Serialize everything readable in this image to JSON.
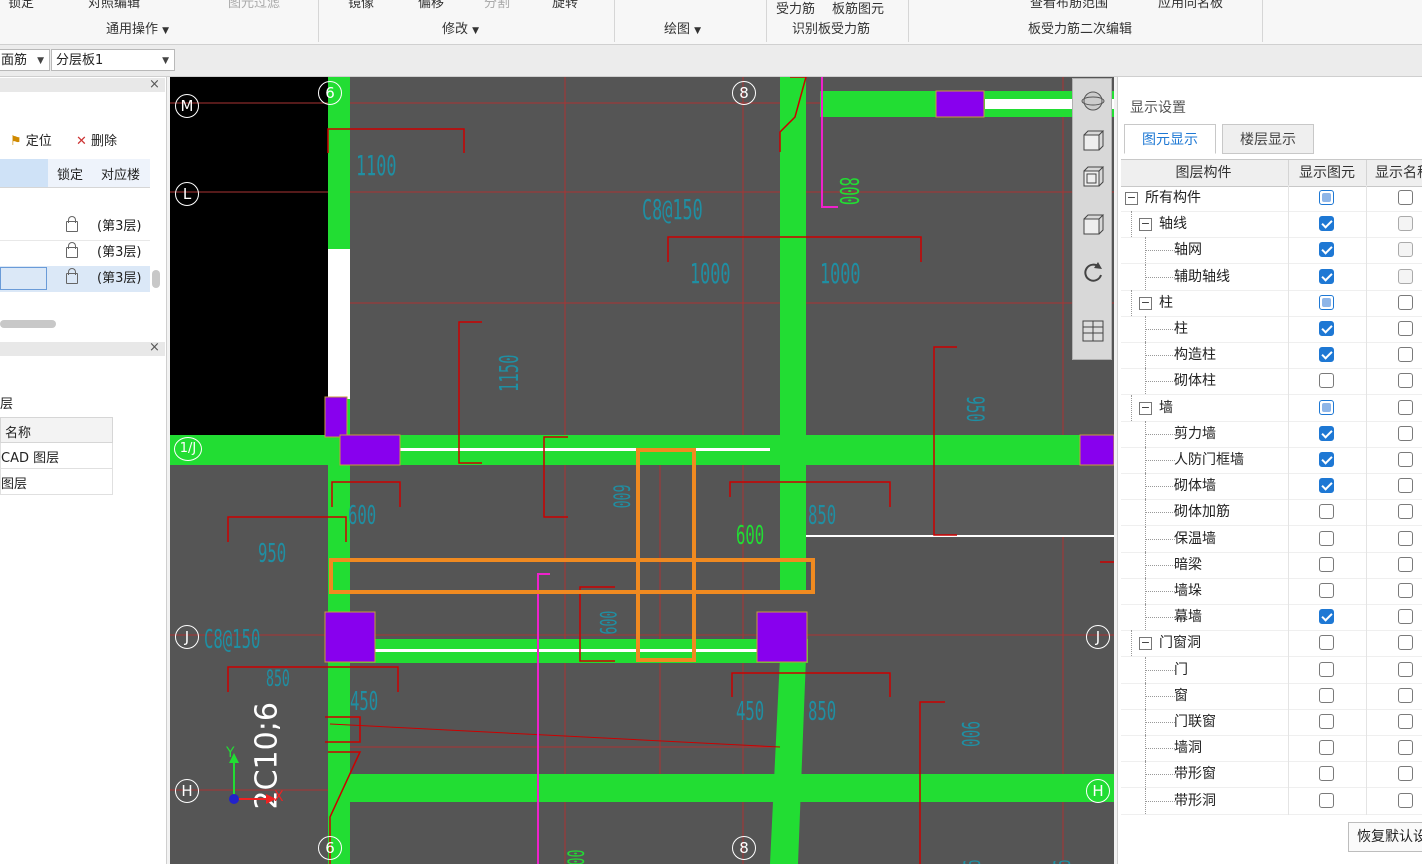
{
  "ribbon": {
    "top_items": [
      "锁定",
      "对照编辑",
      "图元过滤",
      "镜像",
      "偏移",
      "分割",
      "旋转",
      "受力筋",
      "板筋图元",
      "查看布筋范围",
      "应用同名板"
    ],
    "groups": [
      "通用操作",
      "修改",
      "绘图",
      "识别板受力筋",
      "板受力筋二次编辑"
    ]
  },
  "toolbar": {
    "combo1": "面筋",
    "combo2": "分层板1"
  },
  "left_panel": {
    "locate_label": "定位",
    "delete_label": "删除",
    "col_lock": "锁定",
    "col_floor": "对应楼",
    "floor_rows": [
      {
        "floor": "(第3层)"
      },
      {
        "floor": "(第3层)"
      },
      {
        "floor": "(第3层)"
      }
    ],
    "layer_title": "层",
    "layer_col_name": "名称",
    "layer_rows": [
      "CAD 图层",
      "图层"
    ]
  },
  "canvas": {
    "axis_labels": [
      "M",
      "L",
      "1/J",
      "J",
      "J",
      "H",
      "H",
      "6",
      "6",
      "8",
      "8"
    ],
    "dims": [
      "1100",
      "C8@150",
      "1000",
      "1000",
      "800",
      "1150",
      "950",
      "600",
      "950",
      "600",
      "850",
      "850",
      "900",
      "C8@150",
      "600",
      "450",
      "450",
      "850",
      "900",
      "2C10;6",
      "600",
      "00",
      "900"
    ],
    "ucs_x": "X",
    "ucs_y": "Y"
  },
  "right_panel": {
    "title": "显示设置",
    "tabs": [
      "图元显示",
      "楼层显示"
    ],
    "col_component": "图层构件",
    "col_show": "显示图元",
    "col_name": "显示名称",
    "rows": [
      {
        "label": "所有构件",
        "level": 0,
        "group": true,
        "show": "partial",
        "name": "off"
      },
      {
        "label": "轴线",
        "level": 1,
        "group": true,
        "show": "on",
        "name": "dis"
      },
      {
        "label": "轴网",
        "level": 2,
        "group": false,
        "show": "on",
        "name": "dis"
      },
      {
        "label": "辅助轴线",
        "level": 2,
        "group": false,
        "show": "on",
        "name": "dis"
      },
      {
        "label": "柱",
        "level": 1,
        "group": true,
        "show": "partial",
        "name": "off"
      },
      {
        "label": "柱",
        "level": 2,
        "group": false,
        "show": "on",
        "name": "off"
      },
      {
        "label": "构造柱",
        "level": 2,
        "group": false,
        "show": "on",
        "name": "off"
      },
      {
        "label": "砌体柱",
        "level": 2,
        "group": false,
        "show": "off",
        "name": "off"
      },
      {
        "label": "墙",
        "level": 1,
        "group": true,
        "show": "partial",
        "name": "off"
      },
      {
        "label": "剪力墙",
        "level": 2,
        "group": false,
        "show": "on",
        "name": "off"
      },
      {
        "label": "人防门框墙",
        "level": 2,
        "group": false,
        "show": "on",
        "name": "off"
      },
      {
        "label": "砌体墙",
        "level": 2,
        "group": false,
        "show": "on",
        "name": "off"
      },
      {
        "label": "砌体加筋",
        "level": 2,
        "group": false,
        "show": "off",
        "name": "off"
      },
      {
        "label": "保温墙",
        "level": 2,
        "group": false,
        "show": "off",
        "name": "off"
      },
      {
        "label": "暗梁",
        "level": 2,
        "group": false,
        "show": "off",
        "name": "off"
      },
      {
        "label": "墙垛",
        "level": 2,
        "group": false,
        "show": "off",
        "name": "off"
      },
      {
        "label": "幕墙",
        "level": 2,
        "group": false,
        "show": "on",
        "name": "off"
      },
      {
        "label": "门窗洞",
        "level": 1,
        "group": true,
        "show": "off",
        "name": "off"
      },
      {
        "label": "门",
        "level": 2,
        "group": false,
        "show": "off",
        "name": "off"
      },
      {
        "label": "窗",
        "level": 2,
        "group": false,
        "show": "off",
        "name": "off"
      },
      {
        "label": "门联窗",
        "level": 2,
        "group": false,
        "show": "off",
        "name": "off"
      },
      {
        "label": "墙洞",
        "level": 2,
        "group": false,
        "show": "off",
        "name": "off"
      },
      {
        "label": "带形窗",
        "level": 2,
        "group": false,
        "show": "off",
        "name": "off"
      },
      {
        "label": "带形洞",
        "level": 2,
        "group": false,
        "show": "off",
        "name": "off"
      }
    ],
    "restore_label": "恢复默认设置"
  },
  "colors": {
    "canvas_bg": "#555555",
    "slab": "#22dd33",
    "column": "#8800ee",
    "rebar": "#cc0000",
    "dim": "#1f8fa3",
    "highlight": "#f08a20",
    "accent": "#1e78d4"
  }
}
